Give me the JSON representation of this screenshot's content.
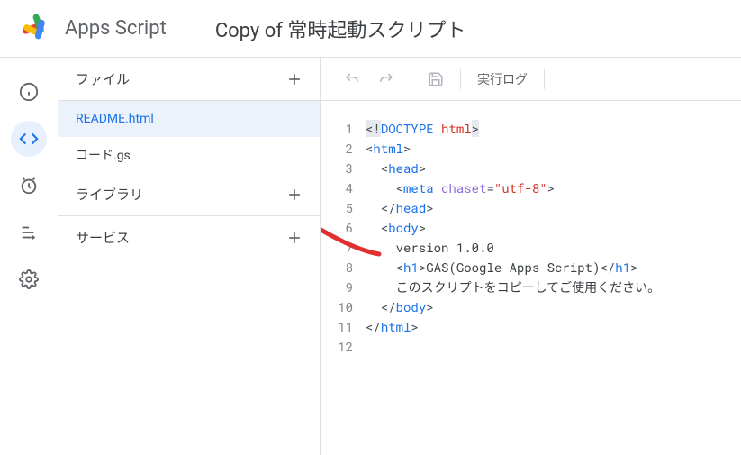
{
  "header": {
    "brand": "Apps Script",
    "project_title": "Copy of 常時起動スクリプト"
  },
  "rail": {
    "items": [
      {
        "name": "overview-icon"
      },
      {
        "name": "editor-icon"
      },
      {
        "name": "triggers-icon"
      },
      {
        "name": "executions-icon"
      },
      {
        "name": "settings-icon"
      }
    ],
    "active_index": 1
  },
  "sidebar": {
    "files_label": "ファイル",
    "files": [
      {
        "name": "README.html",
        "selected": true
      },
      {
        "name": "コード.gs",
        "selected": false
      }
    ],
    "libraries_label": "ライブラリ",
    "services_label": "サービス"
  },
  "toolbar": {
    "undo": "undo",
    "redo": "redo",
    "save": "save",
    "run_log": "実行ログ"
  },
  "code": {
    "lines": [
      {
        "n": 1,
        "tokens": [
          {
            "t": "<!",
            "c": "tok-punc tok-doctype-bg"
          },
          {
            "t": "DOCTYPE ",
            "c": "tok-tag"
          },
          {
            "t": "html",
            "c": "tok-red"
          },
          {
            "t": ">",
            "c": "tok-punc tok-doctype-bg"
          }
        ]
      },
      {
        "n": 2,
        "tokens": [
          {
            "t": "<",
            "c": "tok-punc"
          },
          {
            "t": "html",
            "c": "tok-tag"
          },
          {
            "t": ">",
            "c": "tok-punc"
          }
        ]
      },
      {
        "n": 3,
        "tokens": [
          {
            "t": "  ",
            "c": ""
          },
          {
            "t": "<",
            "c": "tok-punc"
          },
          {
            "t": "head",
            "c": "tok-tag"
          },
          {
            "t": ">",
            "c": "tok-punc"
          }
        ]
      },
      {
        "n": 4,
        "tokens": [
          {
            "t": "    ",
            "c": ""
          },
          {
            "t": "<",
            "c": "tok-punc"
          },
          {
            "t": "meta ",
            "c": "tok-tag"
          },
          {
            "t": "chaset",
            "c": "tok-attr"
          },
          {
            "t": "=",
            "c": "tok-punc"
          },
          {
            "t": "\"utf-8\"",
            "c": "tok-str"
          },
          {
            "t": ">",
            "c": "tok-punc"
          }
        ]
      },
      {
        "n": 5,
        "tokens": [
          {
            "t": "  ",
            "c": ""
          },
          {
            "t": "</",
            "c": "tok-punc"
          },
          {
            "t": "head",
            "c": "tok-tag"
          },
          {
            "t": ">",
            "c": "tok-punc"
          }
        ]
      },
      {
        "n": 6,
        "tokens": [
          {
            "t": "  ",
            "c": ""
          },
          {
            "t": "<",
            "c": "tok-punc"
          },
          {
            "t": "body",
            "c": "tok-tag"
          },
          {
            "t": ">",
            "c": "tok-punc"
          }
        ]
      },
      {
        "n": 7,
        "tokens": [
          {
            "t": "    version 1.0.0",
            "c": "tok-txt"
          }
        ]
      },
      {
        "n": 8,
        "tokens": [
          {
            "t": "    ",
            "c": ""
          },
          {
            "t": "<",
            "c": "tok-punc"
          },
          {
            "t": "h1",
            "c": "tok-tag"
          },
          {
            "t": ">",
            "c": "tok-punc"
          },
          {
            "t": "GAS(Google Apps Script)",
            "c": "tok-txt"
          },
          {
            "t": "</",
            "c": "tok-punc"
          },
          {
            "t": "h1",
            "c": "tok-tag"
          },
          {
            "t": ">",
            "c": "tok-punc"
          }
        ]
      },
      {
        "n": 9,
        "tokens": [
          {
            "t": "    このスクリプトをコピーしてご使用ください。",
            "c": "tok-txt"
          }
        ]
      },
      {
        "n": 10,
        "tokens": [
          {
            "t": "  ",
            "c": ""
          },
          {
            "t": "</",
            "c": "tok-punc"
          },
          {
            "t": "body",
            "c": "tok-tag"
          },
          {
            "t": ">",
            "c": "tok-punc"
          }
        ]
      },
      {
        "n": 11,
        "tokens": [
          {
            "t": "</",
            "c": "tok-punc"
          },
          {
            "t": "html",
            "c": "tok-tag"
          },
          {
            "t": ">",
            "c": "tok-punc"
          }
        ]
      },
      {
        "n": 12,
        "tokens": []
      }
    ]
  }
}
